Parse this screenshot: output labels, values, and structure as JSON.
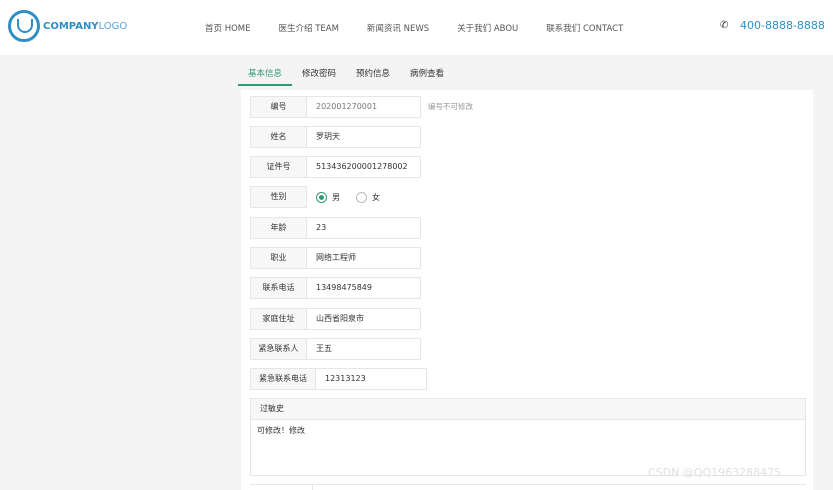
{
  "header": {
    "logo": {
      "bold": "COMPANY",
      "light": "LOGO"
    },
    "nav": [
      "首页 HOME",
      "医生介绍 TEAM",
      "新闻资讯 NEWS",
      "关于我们 ABOU",
      "联系我们 CONTACT"
    ],
    "phone": "400-8888-8888"
  },
  "tabs": [
    "基本信息",
    "修改密码",
    "预约信息",
    "病例查看"
  ],
  "form": {
    "id": {
      "label": "编号",
      "value": "202001270001",
      "hint": "编号不可修改"
    },
    "name": {
      "label": "姓名",
      "value": "罗玥天"
    },
    "cert": {
      "label": "证件号",
      "value": "513436200001278002"
    },
    "gender": {
      "label": "性别",
      "options": [
        "男",
        "女"
      ],
      "selected": "男"
    },
    "age": {
      "label": "年龄",
      "value": "23"
    },
    "job": {
      "label": "职业",
      "value": "网络工程师"
    },
    "phone": {
      "label": "联系电话",
      "value": "13498475849"
    },
    "address": {
      "label": "家庭住址",
      "value": "山西省阳泉市"
    },
    "emergency_contact": {
      "label": "紧急联系人",
      "value": "王五"
    },
    "emergency_phone": {
      "label": "紧急联系电话",
      "value": "12313123"
    },
    "allergy": {
      "label": "过敏史",
      "value": "可修改！修改"
    }
  },
  "watermark": "CSDN @QQ1963288475"
}
